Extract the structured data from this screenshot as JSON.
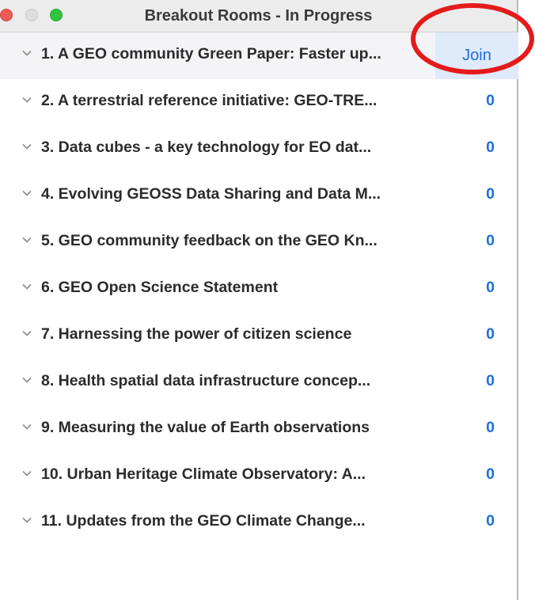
{
  "window": {
    "title": "Breakout Rooms - In Progress"
  },
  "rooms": [
    {
      "name": "1. A GEO community Green Paper: Faster up...",
      "action": "Join"
    },
    {
      "name": "2. A terrestrial reference initiative: GEO-TRE...",
      "count": "0"
    },
    {
      "name": "3. Data cubes - a key technology for EO dat...",
      "count": "0"
    },
    {
      "name": "4. Evolving GEOSS Data Sharing and Data M...",
      "count": "0"
    },
    {
      "name": "5. GEO community feedback on the GEO Kn...",
      "count": "0"
    },
    {
      "name": "6. GEO Open Science Statement",
      "count": "0"
    },
    {
      "name": "7. Harnessing the power of citizen science",
      "count": "0"
    },
    {
      "name": "8. Health spatial data infrastructure concep...",
      "count": "0"
    },
    {
      "name": "9. Measuring the value of Earth observations",
      "count": "0"
    },
    {
      "name": "10. Urban Heritage Climate Observatory: A...",
      "count": "0"
    },
    {
      "name": "11. Updates from the GEO Climate Change...",
      "count": "0"
    }
  ],
  "colors": {
    "accent": "#1e6fde",
    "annotation": "#e31b1b"
  }
}
